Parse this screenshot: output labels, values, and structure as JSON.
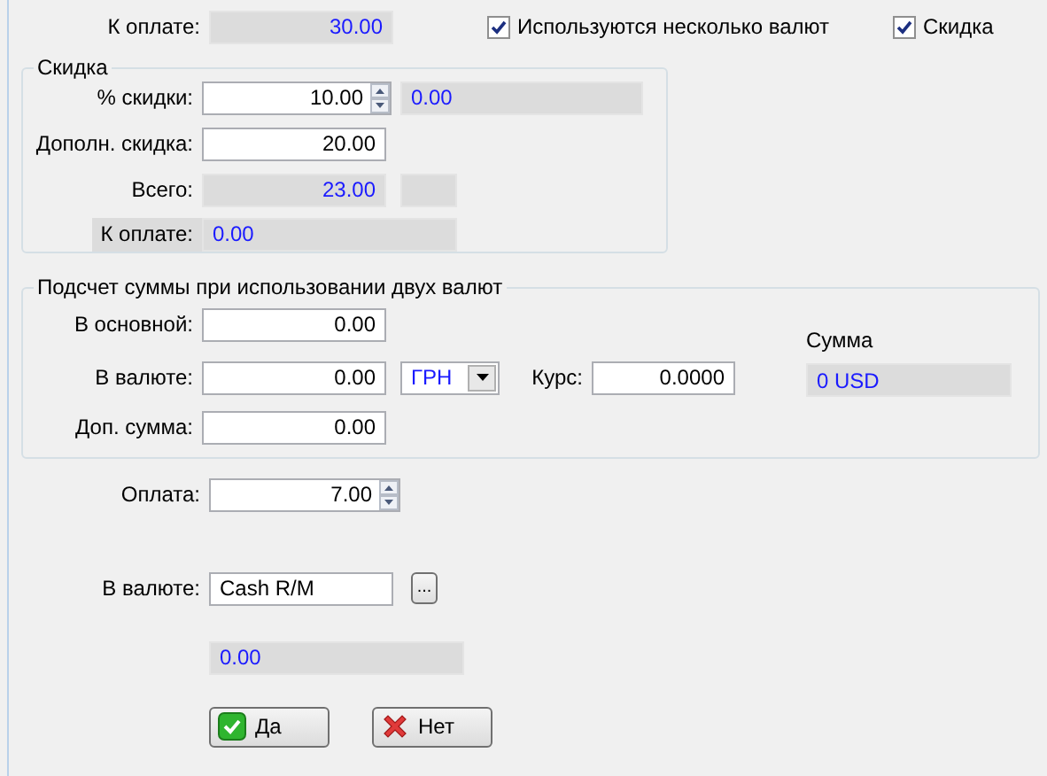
{
  "header": {
    "label": "К оплате:",
    "value": "30.00"
  },
  "options": [
    {
      "label": "Используются несколько валют",
      "checked": true
    },
    {
      "label": "Скидка",
      "checked": true
    }
  ],
  "discount": {
    "title": "Скидка",
    "percent": {
      "label": "% скидки:",
      "value": "10.00",
      "amount": "0.00"
    },
    "extra": {
      "label": "Дополн. скидка:",
      "value": "20.00"
    },
    "total": {
      "label": "Всего:",
      "value": "23.00"
    },
    "to_pay": {
      "label": "К оплате:",
      "value": "0.00"
    }
  },
  "two_currencies": {
    "title": "Подсчет суммы при использовании двух валют",
    "base": {
      "label": "В основной:",
      "value": "0.00"
    },
    "currency": {
      "label": "В валюте:",
      "value": "0.00",
      "currency": "ГРН"
    },
    "rate": {
      "label": "Курс:",
      "value": "0.0000"
    },
    "sum": {
      "label": "Сумма",
      "value": "0 USD"
    },
    "extra_sum": {
      "label": "Доп. сумма:",
      "value": "0.00"
    }
  },
  "payment": {
    "label": "Оплата:",
    "value": "7.00"
  },
  "method": {
    "label": "В валюте:",
    "value": "Cash R/M",
    "browse": "..."
  },
  "remaining": {
    "value": "0.00"
  },
  "buttons": [
    {
      "kind": "ok",
      "label": "Да"
    },
    {
      "kind": "cancel",
      "label": "Нет"
    }
  ]
}
